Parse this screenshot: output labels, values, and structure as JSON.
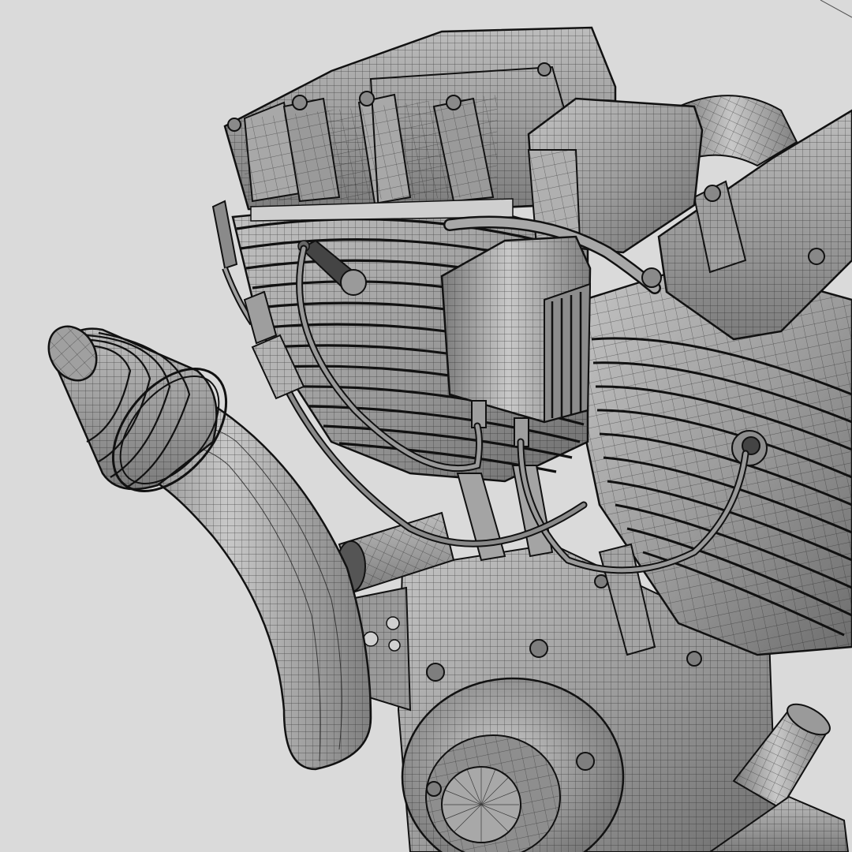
{
  "scene": {
    "background_color": "#dadada",
    "mesh_fill_color": "#9c9c9c",
    "mesh_line_color": "#1e1e1e",
    "shading": "wireframe-on-shaded"
  }
}
